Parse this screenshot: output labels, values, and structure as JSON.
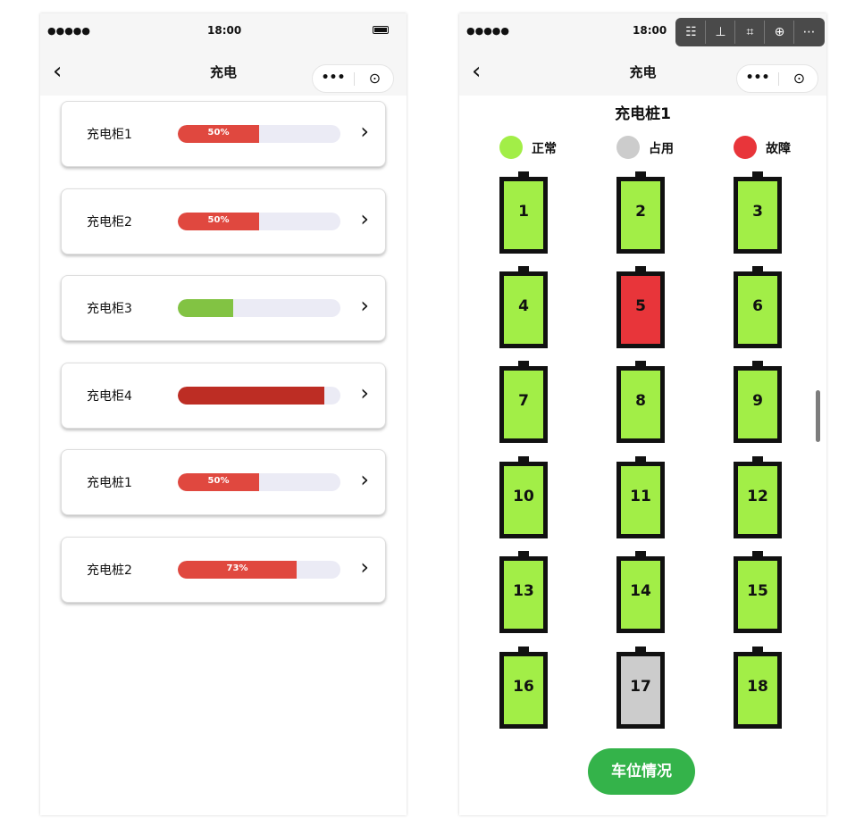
{
  "status": {
    "signal": "●●●●● ",
    "time": "18:00"
  },
  "left": {
    "nav_title": "充电",
    "back_icon": "‹",
    "more_icon": "•••",
    "close_icon": "⊙",
    "chevron_icon": "›",
    "items": [
      {
        "label": "充电柜1",
        "progress": 0.5,
        "pct_label": "50%",
        "color": "#e0483f"
      },
      {
        "label": "充电柜2",
        "progress": 0.5,
        "pct_label": "50%",
        "color": "#e0483f"
      },
      {
        "label": "充电柜3",
        "progress": 0.34,
        "pct_label": "",
        "color": "#82c343"
      },
      {
        "label": "充电柜4",
        "progress": 0.9,
        "pct_label": "",
        "color": "#bd2d24"
      },
      {
        "label": "充电桩1",
        "progress": 0.5,
        "pct_label": "50%",
        "color": "#e0483f"
      },
      {
        "label": "充电桩2",
        "progress": 0.73,
        "pct_label": "73%",
        "color": "#e0483f"
      }
    ]
  },
  "right": {
    "nav_title": "充电",
    "section_title": "充电桩1",
    "legend": [
      {
        "label": "正常",
        "color": "#a2ee47"
      },
      {
        "label": "占用",
        "color": "#cccccc"
      },
      {
        "label": "故障",
        "color": "#e8353a"
      }
    ],
    "slots": [
      {
        "num": "1",
        "state": "normal"
      },
      {
        "num": "2",
        "state": "normal"
      },
      {
        "num": "3",
        "state": "normal"
      },
      {
        "num": "4",
        "state": "normal"
      },
      {
        "num": "5",
        "state": "fault"
      },
      {
        "num": "6",
        "state": "normal"
      },
      {
        "num": "7",
        "state": "normal"
      },
      {
        "num": "8",
        "state": "normal"
      },
      {
        "num": "9",
        "state": "normal"
      },
      {
        "num": "10",
        "state": "normal"
      },
      {
        "num": "11",
        "state": "normal"
      },
      {
        "num": "12",
        "state": "normal"
      },
      {
        "num": "13",
        "state": "normal"
      },
      {
        "num": "14",
        "state": "normal"
      },
      {
        "num": "15",
        "state": "normal"
      },
      {
        "num": "16",
        "state": "normal"
      },
      {
        "num": "17",
        "state": "occupied"
      },
      {
        "num": "18",
        "state": "normal"
      }
    ],
    "state_colors": {
      "normal": "#a2ee47",
      "occupied": "#cccccc",
      "fault": "#e8353a"
    },
    "action_button": "车位情况"
  },
  "toolbar": [
    {
      "name": "comment-icon",
      "glyph": "☷"
    },
    {
      "name": "pin-icon",
      "glyph": "⊥"
    },
    {
      "name": "crop-icon",
      "glyph": "⌗"
    },
    {
      "name": "download-icon",
      "glyph": "⊕"
    },
    {
      "name": "more-icon",
      "glyph": "⋯"
    }
  ]
}
